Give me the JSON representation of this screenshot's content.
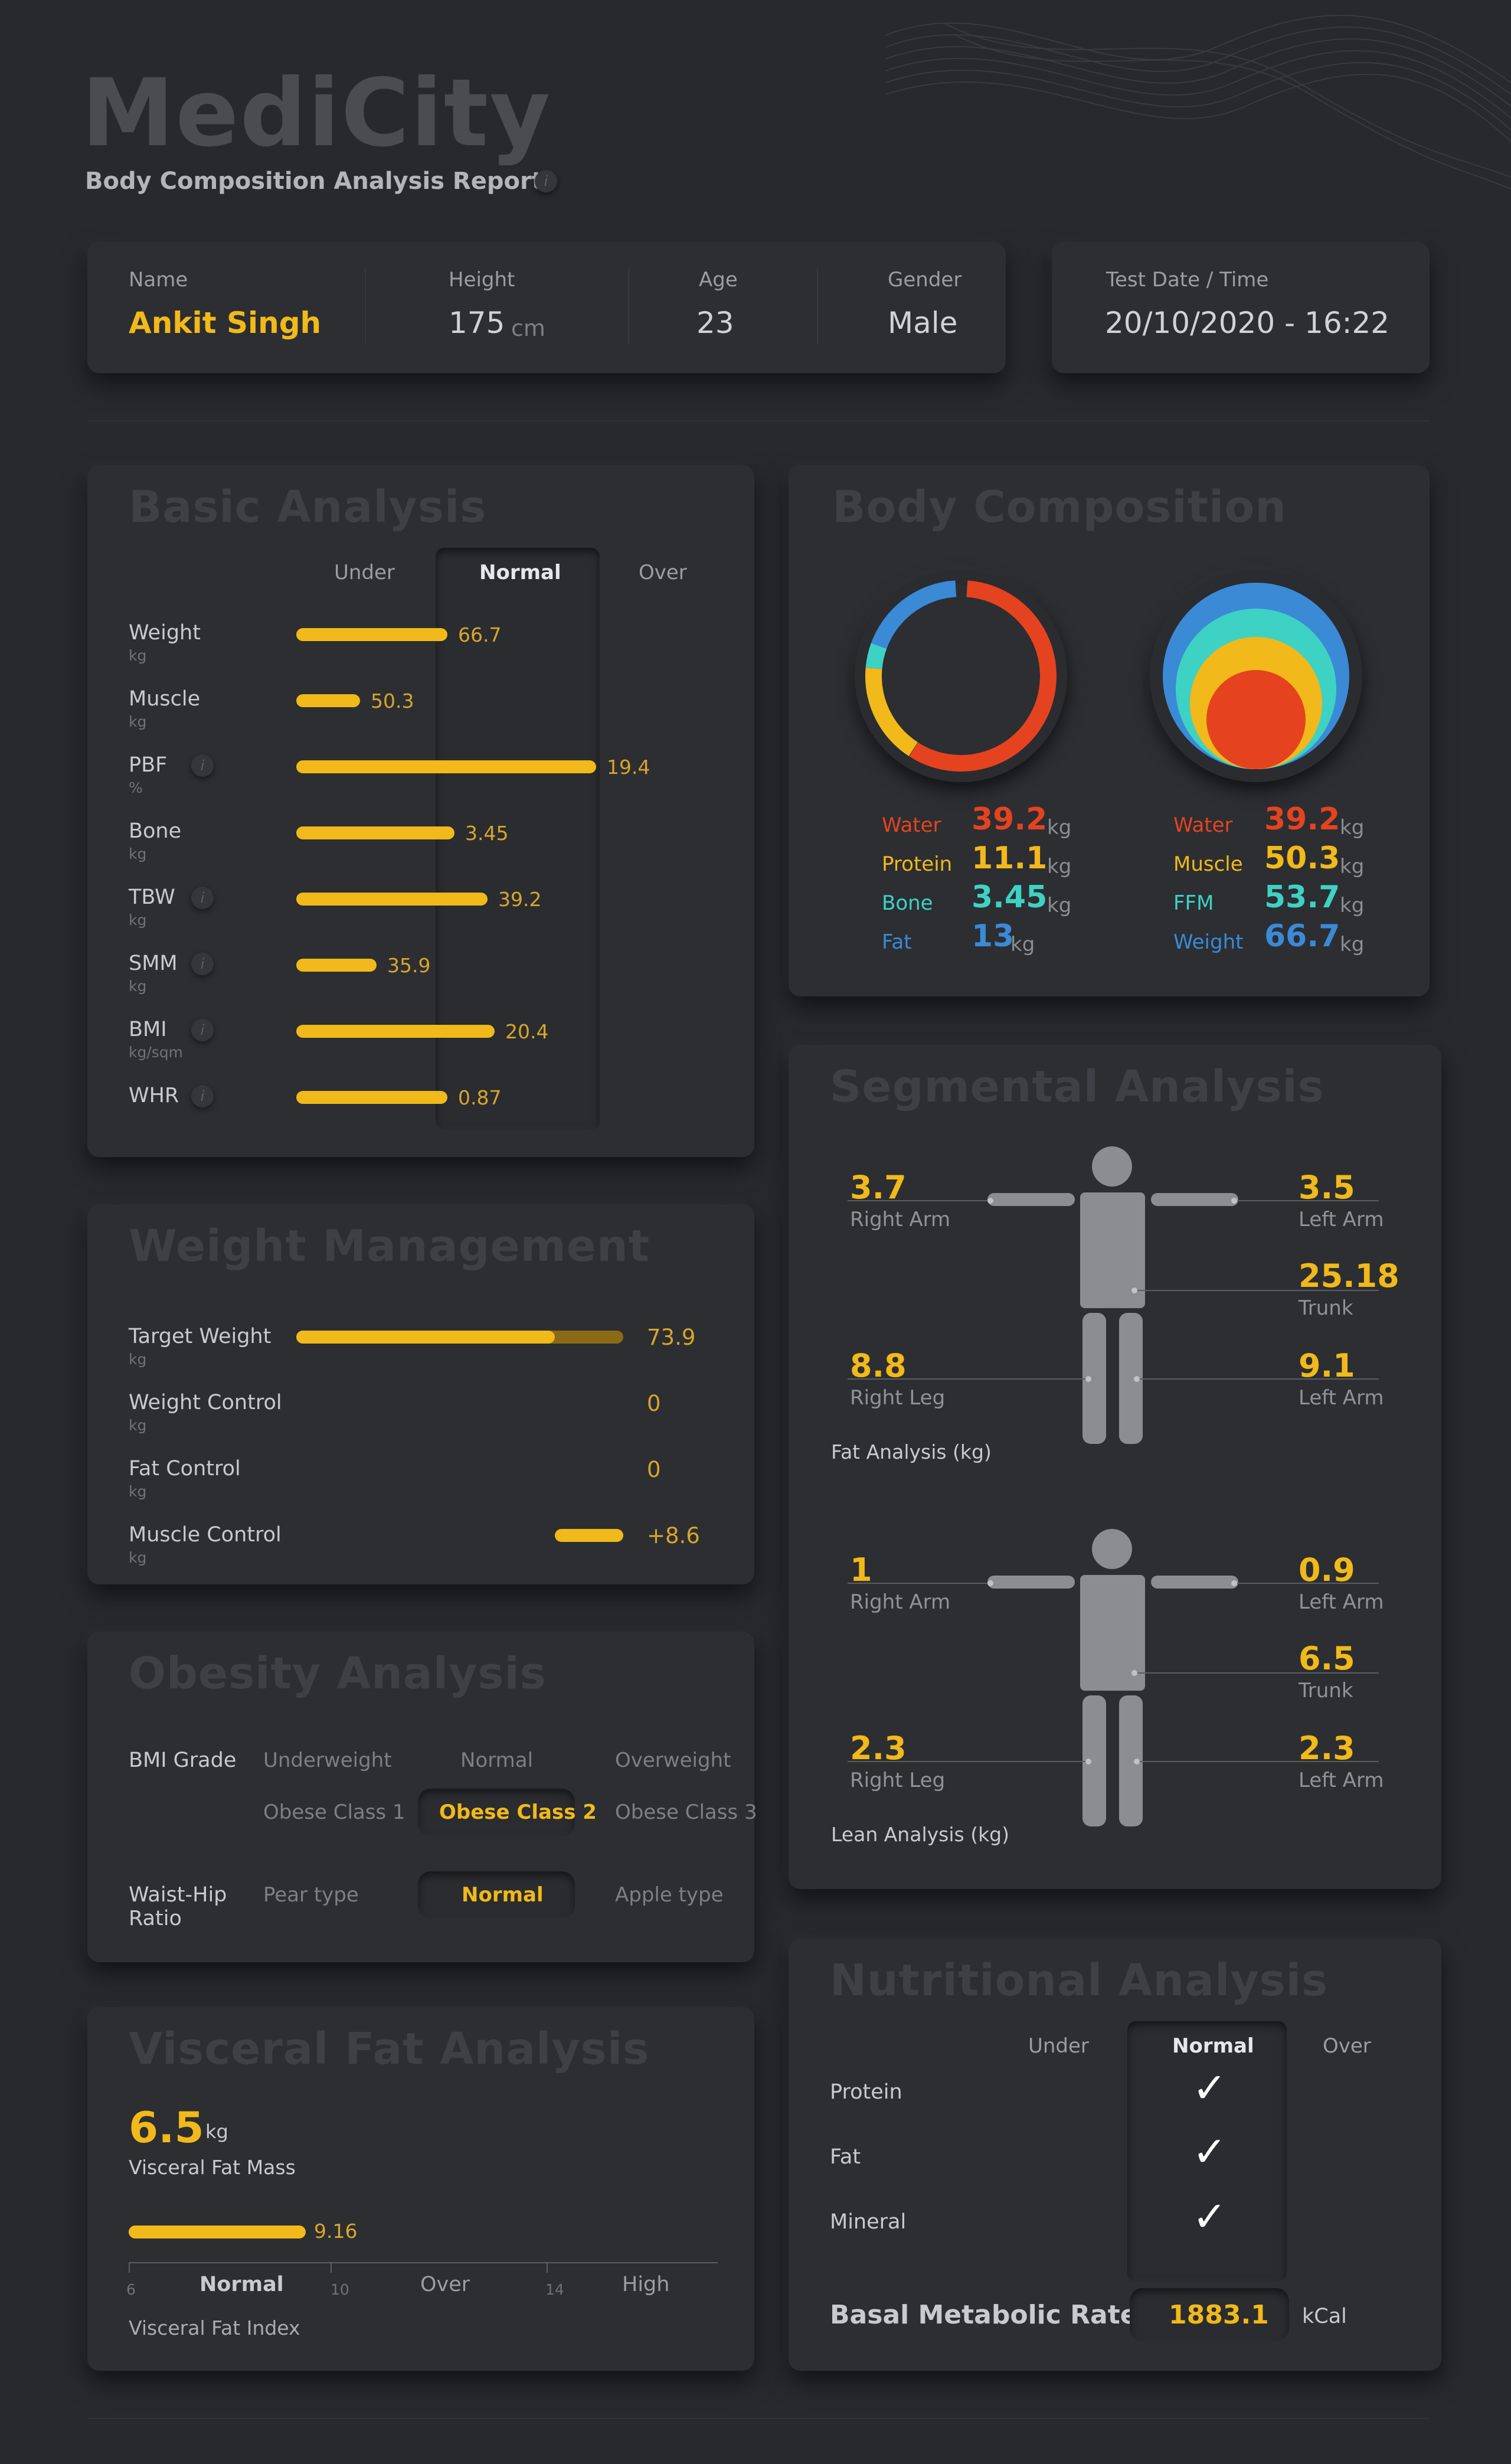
{
  "header": {
    "brand": "MediCity",
    "subtitle": "Body Composition Analysis Report",
    "info": "i"
  },
  "patient": {
    "name_label": "Name",
    "name": "Ankit Singh",
    "height_label": "Height",
    "height": "175",
    "height_unit": "cm",
    "age_label": "Age",
    "age": "23",
    "gender_label": "Gender",
    "gender": "Male",
    "date_label": "Test Date / Time",
    "date": "20/10/2020 - 16:22"
  },
  "basic": {
    "title": "Basic Analysis",
    "cols": {
      "under": "Under",
      "normal": "Normal",
      "over": "Over"
    },
    "rows": [
      {
        "label": "Weight",
        "unit": "kg",
        "value": "66.7",
        "info": false
      },
      {
        "label": "Muscle",
        "unit": "kg",
        "value": "50.3",
        "info": false
      },
      {
        "label": "PBF",
        "unit": "%",
        "value": "19.4",
        "info": true
      },
      {
        "label": "Bone",
        "unit": "kg",
        "value": "3.45",
        "info": false
      },
      {
        "label": "TBW",
        "unit": "kg",
        "value": "39.2",
        "info": true
      },
      {
        "label": "SMM",
        "unit": "kg",
        "value": "35.9",
        "info": true
      },
      {
        "label": "BMI",
        "unit": "kg/sqm",
        "value": "20.4",
        "info": true
      },
      {
        "label": "WHR",
        "unit": "",
        "value": "0.87",
        "info": true
      }
    ]
  },
  "weight": {
    "title": "Weight Management",
    "rows": [
      {
        "label": "Target Weight",
        "unit": "kg",
        "value": "73.9"
      },
      {
        "label": "Weight Control",
        "unit": "kg",
        "value": "0"
      },
      {
        "label": "Fat Control",
        "unit": "kg",
        "value": "0"
      },
      {
        "label": "Muscle Control",
        "unit": "kg",
        "value": "+8.6"
      }
    ]
  },
  "obesity": {
    "title": "Obesity Analysis",
    "bmi_label": "BMI Grade",
    "bmi_options": [
      "Underweight",
      "Normal",
      "Overweight",
      "Obese Class 1",
      "Obese Class 2",
      "Obese Class 3"
    ],
    "bmi_selected": "Obese Class 2",
    "whr_label": "Waist-Hip Ratio",
    "whr_options": [
      "Pear type",
      "Normal",
      "Apple type"
    ],
    "whr_selected": "Normal"
  },
  "visceral": {
    "title": "Visceral Fat Analysis",
    "mass": "6.5",
    "mass_unit": "kg",
    "mass_label": "Visceral Fat Mass",
    "index": "9.16",
    "index_label": "Visceral Fat Index",
    "ticks": [
      "6",
      "10",
      "14"
    ],
    "zones": [
      "Normal",
      "Over",
      "High"
    ]
  },
  "body_comp": {
    "title": "Body Composition",
    "left": [
      {
        "name": "Water",
        "value": "39.2",
        "unit": "kg",
        "color": "#e5431f"
      },
      {
        "name": "Protein",
        "value": "11.1",
        "unit": "kg",
        "color": "#f1b919"
      },
      {
        "name": "Bone",
        "value": "3.45",
        "unit": "kg",
        "color": "#3ed2c4"
      },
      {
        "name": "Fat",
        "value": "13",
        "unit": "kg",
        "color": "#3a8ad6"
      }
    ],
    "right": [
      {
        "name": "Water",
        "value": "39.2",
        "unit": "kg",
        "color": "#e5431f"
      },
      {
        "name": "Muscle",
        "value": "50.3",
        "unit": "kg",
        "color": "#f1b919"
      },
      {
        "name": "FFM",
        "value": "53.7",
        "unit": "kg",
        "color": "#3ed2c4"
      },
      {
        "name": "Weight",
        "value": "66.7",
        "unit": "kg",
        "color": "#3a8ad6"
      }
    ]
  },
  "segmental": {
    "title": "Segmental Analysis",
    "fat": {
      "caption": "Fat Analysis (kg)",
      "right_arm": "3.7",
      "left_arm": "3.5",
      "trunk": "25.18",
      "right_leg": "8.8",
      "left_leg": "9.1",
      "labels": {
        "right_arm": "Right Arm",
        "left_arm": "Left Arm",
        "trunk": "Trunk",
        "right_leg": "Right Leg",
        "left_leg": "Left Arm"
      }
    },
    "lean": {
      "caption": "Lean Analysis (kg)",
      "right_arm": "1",
      "left_arm": "0.9",
      "trunk": "6.5",
      "right_leg": "2.3",
      "left_leg": "2.3",
      "labels": {
        "right_arm": "Right Arm",
        "left_arm": "Left Arm",
        "trunk": "Trunk",
        "right_leg": "Right Leg",
        "left_leg": "Left Arm"
      }
    }
  },
  "nutrition": {
    "title": "Nutritional Analysis",
    "cols": {
      "under": "Under",
      "normal": "Normal",
      "over": "Over"
    },
    "rows": [
      "Protein",
      "Fat",
      "Mineral"
    ],
    "check": "✓",
    "bmr_label": "Basal Metabolic Rate",
    "bmr": "1883.1",
    "bmr_unit": "kCal"
  },
  "colors": {
    "accent": "#f1b919",
    "bg": "#27292d",
    "panel": "#2c2e32",
    "water": "#e5431f",
    "bone": "#3ed2c4",
    "fat": "#3a8ad6"
  }
}
